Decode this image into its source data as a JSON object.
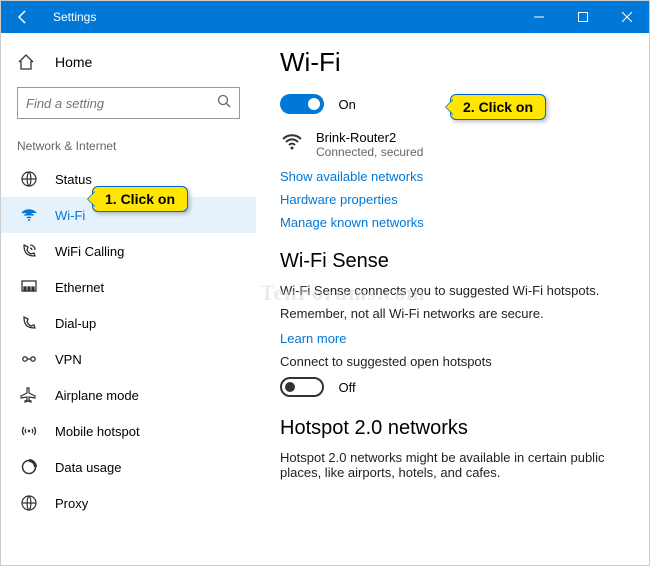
{
  "titlebar": {
    "title": "Settings"
  },
  "sidebar": {
    "home": "Home",
    "search_placeholder": "Find a setting",
    "section": "Network & Internet",
    "items": [
      {
        "label": "Status"
      },
      {
        "label": "Wi-Fi"
      },
      {
        "label": "WiFi Calling"
      },
      {
        "label": "Ethernet"
      },
      {
        "label": "Dial-up"
      },
      {
        "label": "VPN"
      },
      {
        "label": "Airplane mode"
      },
      {
        "label": "Mobile hotspot"
      },
      {
        "label": "Data usage"
      },
      {
        "label": "Proxy"
      }
    ]
  },
  "content": {
    "heading": "Wi-Fi",
    "toggle_state": "On",
    "network": {
      "name": "Brink-Router2",
      "status": "Connected, secured"
    },
    "link_show": "Show available networks",
    "link_hw": "Hardware properties",
    "link_known": "Manage known networks",
    "sense_heading": "Wi-Fi Sense",
    "sense_para1": "Wi-Fi Sense connects you to suggested Wi-Fi hotspots.",
    "sense_para2": "Remember, not all Wi-Fi networks are secure.",
    "link_learn": "Learn more",
    "suggested_label": "Connect to suggested open hotspots",
    "suggested_state": "Off",
    "hotspot20_heading": "Hotspot 2.0 networks",
    "hotspot20_para": "Hotspot 2.0 networks might be available in certain public places, like airports, hotels, and cafes."
  },
  "callouts": {
    "c1": "1. Click on",
    "c2": "2. Click on"
  },
  "watermark": "TenForums.com"
}
